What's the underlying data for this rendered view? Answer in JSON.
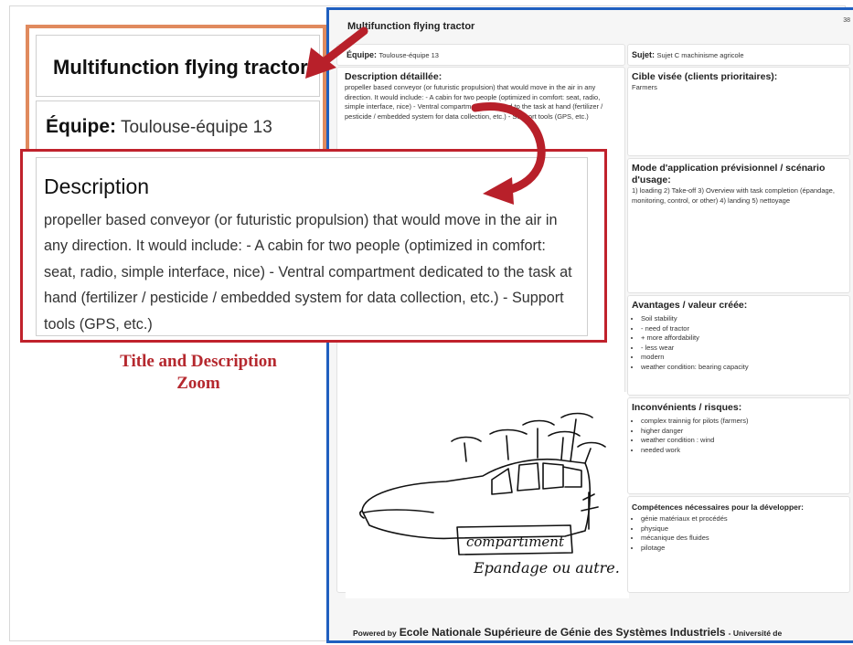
{
  "zoom": {
    "title": "Multifunction flying tractor",
    "team_label": "Équipe:",
    "team_value": "Toulouse-équipe 13",
    "description_heading": "Description",
    "description_text": "propeller based conveyor (or futuristic propulsion) that would move in the air in any direction. It would include: - A cabin for two people (optimized in comfort: seat, radio, simple interface, nice) - Ventral compartment dedicated to the task at hand (fertilizer / pesticide / embedded system for data collection, etc.) - Support tools (GPS, etc.)"
  },
  "caption": {
    "line1": "Title and Description",
    "line2": "Zoom"
  },
  "document": {
    "title": "Multifunction flying tractor",
    "page_number": "38",
    "team_label": "Équipe:",
    "team_value": "Toulouse-équipe 13",
    "subject_label": "Sujet:",
    "subject_value": "Sujet C machinisme agricole",
    "description_heading": "Description détaillée:",
    "description_text": "propeller based conveyor (or futuristic propulsion) that would move in the air in any direction. It would include: - A cabin for two people (optimized in comfort: seat, radio, simple interface, nice) - Ventral compartment dedicated to the task at hand (fertilizer / pesticide / embedded system for data collection, etc.) - Support tools (GPS, etc.)",
    "target_heading": "Cible visée (clients prioritaires):",
    "target_text": "Farmers",
    "usage_heading": "Mode d'application prévisionnel / scénario d'usage:",
    "usage_text": "1) loading 2) Take-off 3) Overview with task completion (épandage, monitoring, control, or other) 4) landing 5) nettoyage",
    "advantages_heading": "Avantages / valeur créée:",
    "advantages": [
      "Soil stability",
      "- need of tractor",
      "+ more affordability",
      "- less wear",
      "modern",
      "weather condition: bearing capacity"
    ],
    "drawbacks_heading": "Inconvénients / risques:",
    "drawbacks": [
      "complex trainnig for pilots (farmers)",
      "higher danger",
      "weather condition : wind",
      "needed work"
    ],
    "skills_heading": "Compétences nécessaires pour la développer:",
    "skills": [
      "génie matériaux et procédés",
      "physique",
      "mécanique des fluides",
      "pilotage"
    ],
    "sketch_text1": "compartiment",
    "sketch_text2": "Epandage ou autre.",
    "footer_powered": "Powered by",
    "footer_school": "Ecole Nationale Supérieure de Génie des Systèmes Industriels",
    "footer_univ": "- Université de"
  },
  "colors": {
    "doc_border": "#1f5fbf",
    "title_zoom_border": "#e08a5e",
    "desc_zoom_border": "#c0222c",
    "caption": "#b5282e"
  }
}
